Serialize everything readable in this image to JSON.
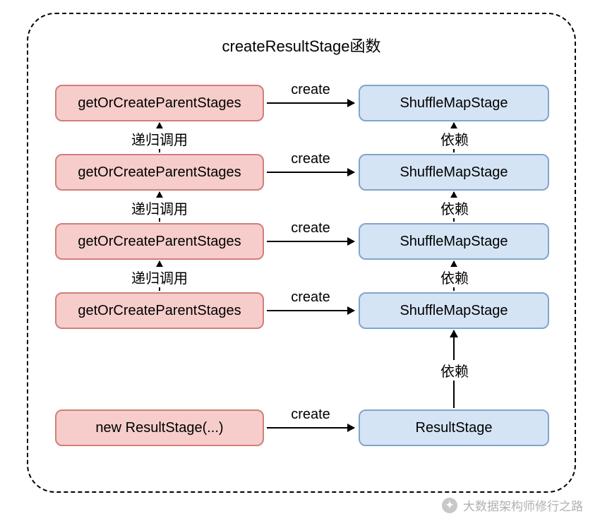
{
  "title": "createResultStage函数",
  "leftNodes": [
    {
      "label": "getOrCreateParentStages"
    },
    {
      "label": "getOrCreateParentStages"
    },
    {
      "label": "getOrCreateParentStages"
    },
    {
      "label": "getOrCreateParentStages"
    },
    {
      "label": "new ResultStage(...)"
    }
  ],
  "rightNodes": [
    {
      "label": "ShuffleMapStage"
    },
    {
      "label": "ShuffleMapStage"
    },
    {
      "label": "ShuffleMapStage"
    },
    {
      "label": "ShuffleMapStage"
    },
    {
      "label": "ResultStage"
    }
  ],
  "hArrowLabels": [
    "create",
    "create",
    "create",
    "create",
    "create"
  ],
  "vLeftLabels": [
    "递归调用",
    "递归调用",
    "递归调用"
  ],
  "vRightLabels": [
    "依赖",
    "依赖",
    "依赖",
    "依赖"
  ],
  "watermark": "大数据架构师修行之路"
}
